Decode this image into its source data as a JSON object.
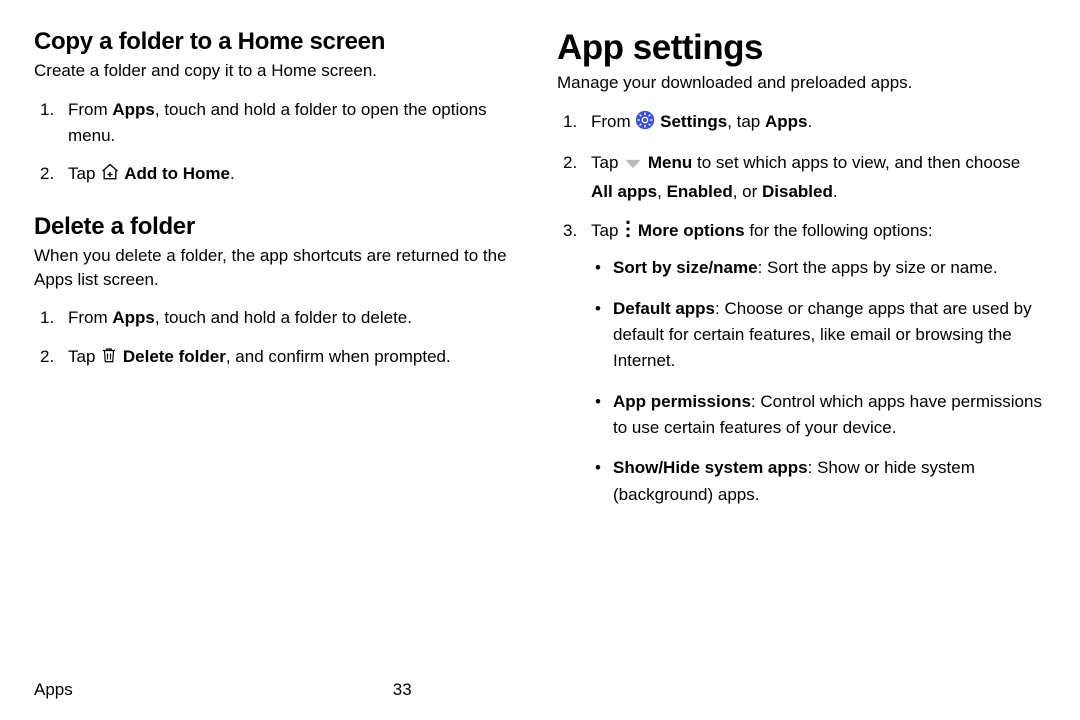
{
  "left": {
    "copy": {
      "heading": "Copy a folder to a Home screen",
      "lead": "Create a folder and copy it to a Home screen.",
      "step1_a": "From ",
      "step1_b": "Apps",
      "step1_c": ", touch and hold a folder to open the options menu.",
      "step2_a": "Tap ",
      "step2_b": " Add to Home",
      "step2_c": "."
    },
    "delete": {
      "heading": "Delete a folder",
      "lead": "When you delete a folder, the app shortcuts are returned to the Apps list screen.",
      "step1_a": "From ",
      "step1_b": "Apps",
      "step1_c": ", touch and hold a folder to delete.",
      "step2_a": "Tap ",
      "step2_b": " Delete folder",
      "step2_c": ", and confirm when prompted."
    }
  },
  "right": {
    "heading": "App settings",
    "lead": "Manage your downloaded and preloaded apps.",
    "step1_a": "From ",
    "step1_b": " Settings",
    "step1_c": ", tap ",
    "step1_d": "Apps",
    "step1_e": ".",
    "step2_a": "Tap ",
    "step2_b": " Menu",
    "step2_c": " to set which apps to view, and then choose ",
    "step2_d": "All apps",
    "step2_e": ", ",
    "step2_f": "Enabled",
    "step2_g": ", or ",
    "step2_h": "Disabled",
    "step2_i": ".",
    "step3_a": "Tap ",
    "step3_b": " More options",
    "step3_c": " for the following options:",
    "bullets": {
      "b1_a": "Sort by size/name",
      "b1_b": ": Sort the apps by size or name.",
      "b2_a": "Default apps",
      "b2_b": ": Choose or change apps that are used by default for certain features, like email or browsing the Internet.",
      "b3_a": "App permissions",
      "b3_b": ": Control which apps have permissions to use certain features of your device.",
      "b4_a": "Show/Hide system apps",
      "b4_b": ": Show or hide system (background) apps."
    }
  },
  "footer": {
    "section": "Apps",
    "page": "33"
  }
}
